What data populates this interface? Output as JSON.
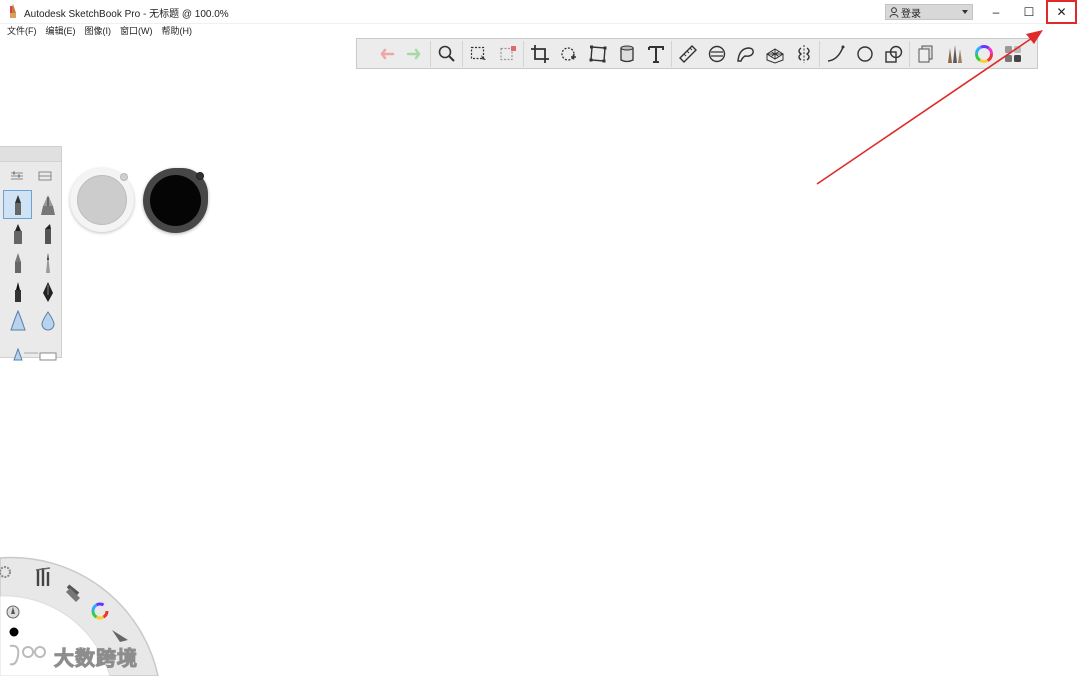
{
  "window": {
    "title": "Autodesk SketchBook Pro - 无标题 @ 100.0%",
    "login_label": "登录",
    "minimize_symbol": "–",
    "maximize_symbol": "☐",
    "close_symbol": "✕"
  },
  "menu": [
    {
      "label": "文件(F)"
    },
    {
      "label": "编辑(E)"
    },
    {
      "label": "图像(I)"
    },
    {
      "label": "窗口(W)"
    },
    {
      "label": "帮助(H)"
    }
  ],
  "toolbar": {
    "items": [
      {
        "name": "undo-icon",
        "color": "#f0a6a6"
      },
      {
        "name": "redo-icon",
        "color": "#a6d9a6"
      },
      {
        "name": "zoom-icon"
      },
      {
        "name": "select-icon"
      },
      {
        "name": "transform-icon"
      },
      {
        "name": "crop-icon"
      },
      {
        "name": "distort-icon"
      },
      {
        "name": "perspective-icon"
      },
      {
        "name": "fill-icon"
      },
      {
        "name": "text-icon"
      },
      {
        "name": "ruler-icon"
      },
      {
        "name": "ellipse-guide-icon"
      },
      {
        "name": "french-curve-icon"
      },
      {
        "name": "perspective-grid-icon"
      },
      {
        "name": "symmetry-icon"
      },
      {
        "name": "stroke-icon"
      },
      {
        "name": "circle-icon"
      },
      {
        "name": "shapes-icon"
      },
      {
        "name": "layers-icon"
      },
      {
        "name": "brushes-icon"
      },
      {
        "name": "color-wheel-icon"
      },
      {
        "name": "copic-library-icon"
      }
    ]
  },
  "brush_panel": {
    "brushes": [
      {
        "name": "pencil-brush"
      },
      {
        "name": "ink-pen-brush"
      },
      {
        "name": "marker-brush"
      },
      {
        "name": "chisel-marker-brush"
      },
      {
        "name": "ballpoint-brush"
      },
      {
        "name": "fine-pencil-brush"
      },
      {
        "name": "technical-pen-brush"
      },
      {
        "name": "fountain-pen-brush"
      },
      {
        "name": "airbrush-brush"
      },
      {
        "name": "water-drop-brush"
      },
      {
        "name": "triangle-brush"
      },
      {
        "name": "eraser-brush"
      }
    ]
  },
  "pucks": {
    "size_color": "#cccccc",
    "opacity_color": "#050505"
  },
  "watermark": {
    "text": "大数跨境"
  },
  "colors": {
    "accent_red": "#e02a2a",
    "toolbar_bg": "#ececec"
  }
}
